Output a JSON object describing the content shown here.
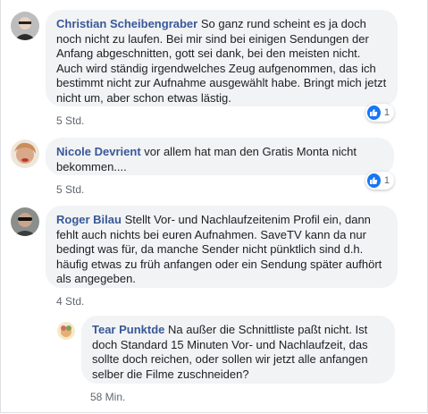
{
  "comments": [
    {
      "author": "Christian Scheibengraber",
      "text": "So ganz rund scheint es ja doch noch nicht zu laufen. Bei mir sind bei einigen Sendungen der Anfang abgeschnitten, gott sei dank, bei den meisten nicht. Auch wird ständig irgendwelches Zeug aufgenommen, das ich bestimmt nicht zur Aufnahme ausgewählt habe. Bringt mich jetzt nicht um, aber schon etwas lästig.",
      "time": "5 Std.",
      "reactions": "1"
    },
    {
      "author": "Nicole Devrient",
      "text": "vor allem hat man den Gratis Monta nicht bekommen....",
      "time": "5 Std.",
      "reactions": "1"
    },
    {
      "author": "Roger Bilau",
      "text": "Stellt Vor- und Nachlaufzeitenim Profil ein, dann fehlt auch nichts bei euren Aufnahmen. SaveTV kann da nur bedingt was für, da manche Sender nicht pünktlich sind d.h. häufig etwas zu früh anfangen oder ein Sendung später aufhört als angegeben.",
      "time": "4 Std."
    },
    {
      "author": "Tear Punktde",
      "text": "Na außer die Schnittliste paßt nicht. Ist doch Standard 15 Minuten Vor- und Nachlaufzeit, das sollte doch reichen, oder sollen wir jetzt alle anfangen selber die Filme zuschneiden?",
      "time": "58 Min."
    }
  ],
  "colors": {
    "author": "#385898",
    "bubble": "#f2f3f5",
    "like": "#1877f2"
  },
  "icons": [
    "like-icon",
    "avatar"
  ]
}
